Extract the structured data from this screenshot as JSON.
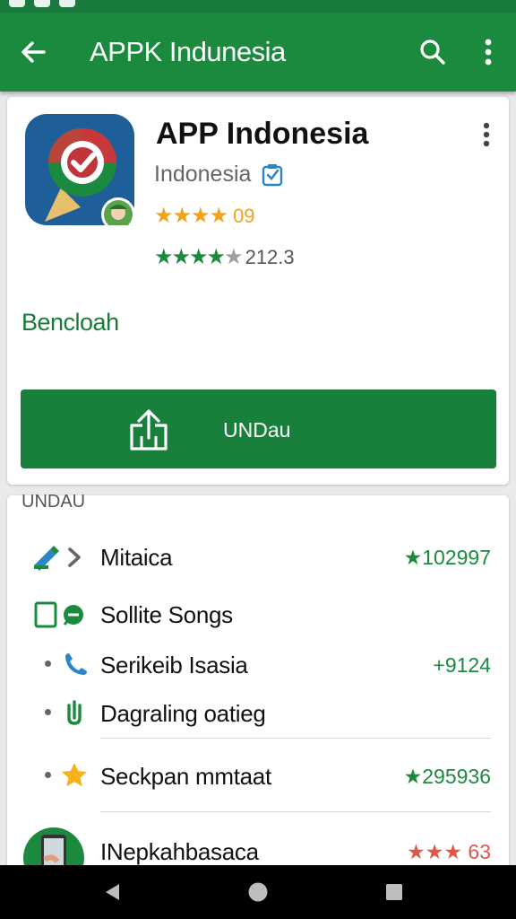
{
  "app_bar": {
    "title": "APPK Indunesia"
  },
  "app": {
    "name": "APP Indonesia",
    "developer": "Indonesia",
    "rating_value": "09",
    "review_count": "212.3",
    "download_label": "Bencloah",
    "install_button_label": "UNDau"
  },
  "list": {
    "header": "UNDAU",
    "items": [
      {
        "label": "Mitaica",
        "value": "★102997"
      },
      {
        "label": "Sollite Songs",
        "value": ""
      },
      {
        "label": "Serikeib Isasia",
        "value": "+9124"
      },
      {
        "label": "Dagraling oatieg",
        "value": ""
      },
      {
        "label": "Seckpan mmtaat",
        "value": "★295936"
      },
      {
        "label": "INepkahbasaca",
        "value": "★★★ 63"
      }
    ]
  },
  "colors": {
    "primary": "#1b8a3f",
    "star": "#f2a21b",
    "list_value_red": "#e0574a"
  }
}
